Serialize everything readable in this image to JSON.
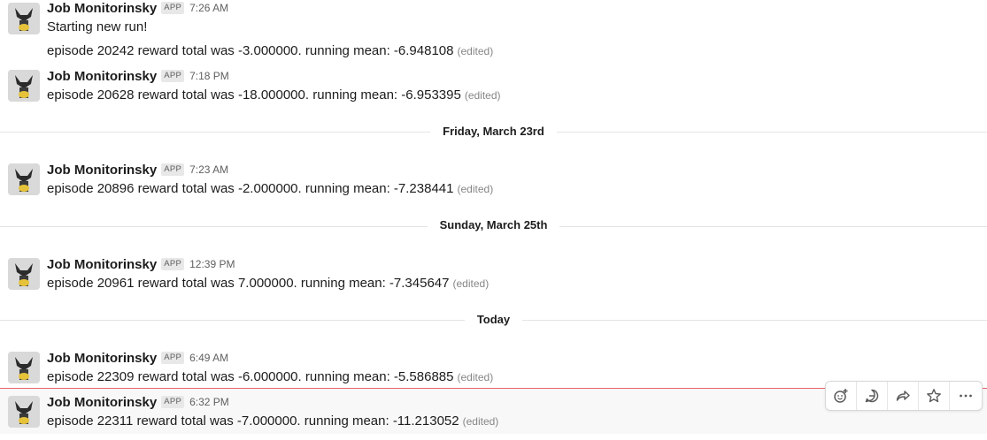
{
  "sender": {
    "name": "Job Monitorinsky",
    "badge": "APP"
  },
  "edited_label": "(edited)",
  "messages": [
    {
      "time": "7:26 AM",
      "lines": [
        "Starting new run!",
        "episode 20242 reward total was -3.000000. running mean: -6.948108"
      ]
    },
    {
      "time": "7:18 PM",
      "lines": [
        "episode 20628 reward total was -18.000000. running mean: -6.953395"
      ]
    },
    {
      "time": "7:23 AM",
      "lines": [
        "episode 20896 reward total was -2.000000. running mean: -7.238441"
      ]
    },
    {
      "time": "12:39 PM",
      "lines": [
        "episode 20961 reward total was 7.000000. running mean: -7.345647"
      ]
    },
    {
      "time": "6:49 AM",
      "lines": [
        "episode 22309 reward total was -6.000000. running mean: -5.586885"
      ]
    },
    {
      "time": "6:32 PM",
      "lines": [
        "episode 22311 reward total was -7.000000. running mean: -11.213052"
      ]
    }
  ],
  "dividers": [
    "Friday, March 23rd",
    "Sunday, March 25th",
    "Today"
  ],
  "hover_toolbar": [
    "add-reaction-icon",
    "reply-in-thread-icon",
    "share-icon",
    "star-icon",
    "more-actions-icon"
  ]
}
